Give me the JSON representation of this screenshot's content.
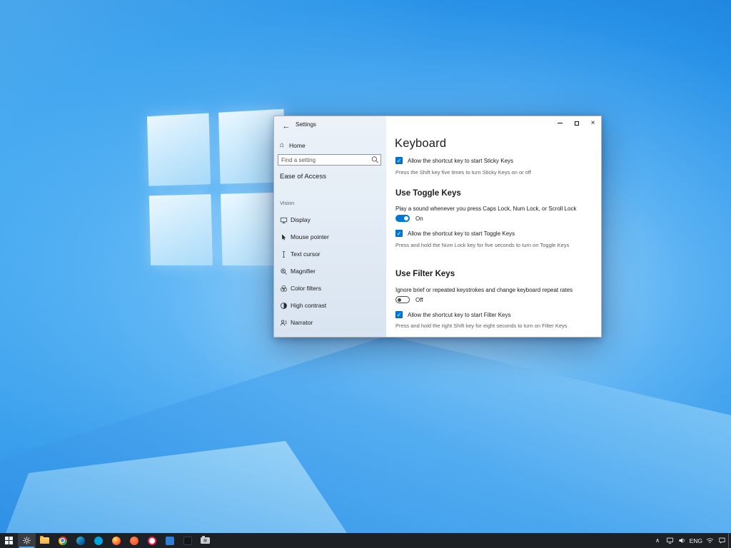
{
  "window": {
    "title": "Settings",
    "nav": {
      "home_label": "Home",
      "search_placeholder": "Find a setting",
      "category": "Ease of Access",
      "group": "Vision",
      "items": [
        {
          "label": "Display"
        },
        {
          "label": "Mouse pointer"
        },
        {
          "label": "Text cursor"
        },
        {
          "label": "Magnifier"
        },
        {
          "label": "Color filters"
        },
        {
          "label": "High contrast"
        },
        {
          "label": "Narrator"
        }
      ]
    },
    "page": {
      "title": "Keyboard",
      "sticky_keys": {
        "checkbox_label": "Allow the shortcut key to start Sticky Keys",
        "checkbox_checked": true,
        "description": "Press the Shift key five times to turn Sticky Keys on or off"
      },
      "toggle_keys": {
        "heading": "Use Toggle Keys",
        "setting_label": "Play a sound whenever you press Caps Lock, Num Lock, or Scroll Lock",
        "toggle_state": "On",
        "checkbox_label": "Allow the shortcut key to start Toggle Keys",
        "checkbox_checked": true,
        "description": "Press and hold the Num Lock key for five seconds to turn on Toggle Keys"
      },
      "filter_keys": {
        "heading": "Use Filter Keys",
        "setting_label": "Ignore brief or repeated keystrokes and change keyboard repeat rates",
        "toggle_state": "Off",
        "checkbox_label": "Allow the shortcut key to start Filter Keys",
        "checkbox_checked": true,
        "description": "Press and hold the right Shift key for eight seconds to turn on Filter Keys"
      }
    }
  },
  "taskbar": {
    "tray": {
      "language": "ENG"
    }
  },
  "colors": {
    "accent": "#0078d7",
    "taskbar": "#1d2024",
    "text_secondary": "#5e5e5e"
  },
  "icons": {
    "back": "←",
    "home": "⌂",
    "close": "×",
    "check": "✓",
    "chevron_up": "∧"
  }
}
